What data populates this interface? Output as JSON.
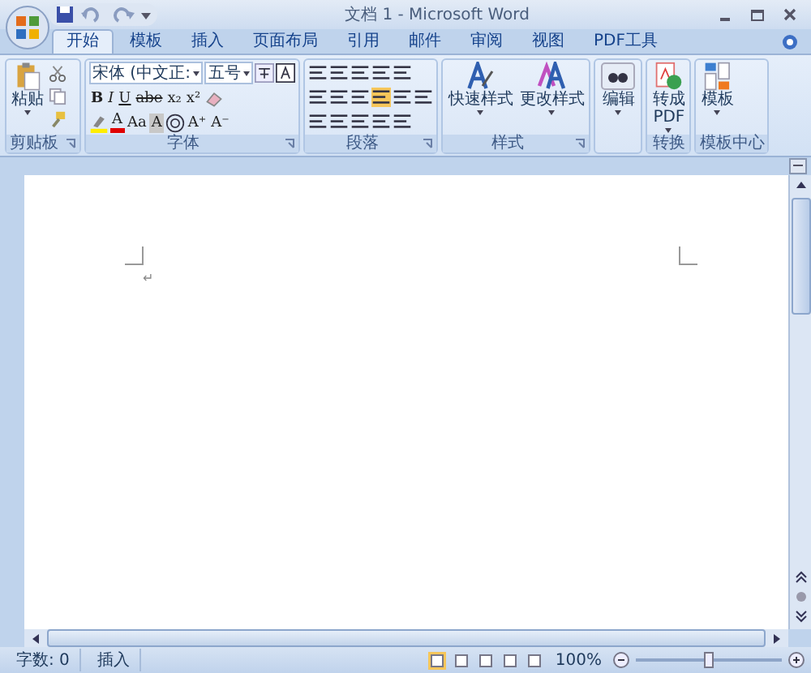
{
  "window": {
    "title": "文档 1 - Microsoft Word"
  },
  "tabs": [
    {
      "label": "开始",
      "selected": true
    },
    {
      "label": "模板",
      "selected": false
    },
    {
      "label": "插入",
      "selected": false
    },
    {
      "label": "页面布局",
      "selected": false
    },
    {
      "label": "引用",
      "selected": false
    },
    {
      "label": "邮件",
      "selected": false
    },
    {
      "label": "审阅",
      "selected": false
    },
    {
      "label": "视图",
      "selected": false
    },
    {
      "label": "PDF工具",
      "selected": false
    }
  ],
  "clipboard": {
    "label": "剪贴板",
    "paste": "粘贴"
  },
  "font": {
    "label": "字体",
    "font_name": "宋体 (中文正:",
    "font_size": "五号",
    "row2": [
      {
        "text": "B",
        "kind": "bold"
      },
      {
        "text": "I",
        "kind": "italic"
      },
      {
        "text": "U",
        "kind": "underline"
      },
      {
        "text": "abe",
        "kind": "strike"
      },
      {
        "text": "x₂",
        "kind": "plain"
      },
      {
        "text": "x²",
        "kind": "plain"
      }
    ],
    "row3": [
      {
        "text": "A",
        "kind": "color"
      },
      {
        "text": "Aa",
        "kind": "plain"
      },
      {
        "text": "A",
        "kind": "shaded"
      },
      {
        "text": "A⁺",
        "kind": "plain"
      },
      {
        "text": "A⁻",
        "kind": "plain"
      }
    ]
  },
  "paragraph": {
    "label": "段落"
  },
  "styles": {
    "label": "样式",
    "buttons": [
      "快速样式",
      "更改样式"
    ]
  },
  "editing": {
    "button": "编辑"
  },
  "convert": {
    "label": "转换",
    "button": "转成\nPDF"
  },
  "template_center": {
    "label": "模板中心",
    "button": "模板"
  },
  "document": {
    "paragraph_mark": "↵"
  },
  "status_bar": {
    "word_count": "字数: 0",
    "mode": "插入",
    "zoom": "100%",
    "zoom_slider": {
      "level": 0.5
    }
  }
}
